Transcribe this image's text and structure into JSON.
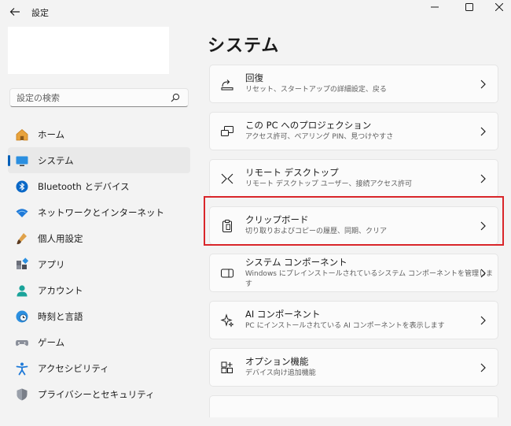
{
  "window": {
    "title": "設定"
  },
  "search": {
    "placeholder": "設定の検索"
  },
  "sidebar": {
    "items": [
      {
        "label": "ホーム",
        "icon": "home-icon",
        "selected": false
      },
      {
        "label": "システム",
        "icon": "system-display-icon",
        "selected": true
      },
      {
        "label": "Bluetooth とデバイス",
        "icon": "bluetooth-icon",
        "selected": false
      },
      {
        "label": "ネットワークとインターネット",
        "icon": "wifi-icon",
        "selected": false
      },
      {
        "label": "個人用設定",
        "icon": "paint-brush-icon",
        "selected": false
      },
      {
        "label": "アプリ",
        "icon": "apps-icon",
        "selected": false
      },
      {
        "label": "アカウント",
        "icon": "account-icon",
        "selected": false
      },
      {
        "label": "時刻と言語",
        "icon": "globe-clock-icon",
        "selected": false
      },
      {
        "label": "ゲーム",
        "icon": "gamepad-icon",
        "selected": false
      },
      {
        "label": "アクセシビリティ",
        "icon": "accessibility-icon",
        "selected": false
      },
      {
        "label": "プライバシーとセキュリティ",
        "icon": "shield-icon",
        "selected": false
      }
    ]
  },
  "main": {
    "title": "システム",
    "cards": [
      {
        "title": "回復",
        "description": "リセット、スタートアップの詳細設定、戻る",
        "icon": "recovery-icon"
      },
      {
        "title": "この PC へのプロジェクション",
        "description": "アクセス許可、ペアリング PIN、見つけやすさ",
        "icon": "projection-icon"
      },
      {
        "title": "リモート デスクトップ",
        "description": "リモート デスクトップ ユーザー、接続アクセス許可",
        "icon": "remote-desktop-icon"
      },
      {
        "title": "クリップボード",
        "description": "切り取りおよびコピーの履歴、同期、クリア",
        "icon": "clipboard-icon",
        "highlighted": true
      },
      {
        "title": "システム コンポーネント",
        "description": "Windows にプレインストールされているシステム コンポーネントを管理します",
        "icon": "system-components-icon"
      },
      {
        "title": "AI コンポーネント",
        "description": "PC にインストールされている AI コンポーネントを表示します",
        "icon": "ai-sparkle-icon"
      },
      {
        "title": "オプション機能",
        "description": "デバイス向け追加機能",
        "icon": "optional-features-icon"
      }
    ]
  },
  "colors": {
    "accent": "#005fb8",
    "highlight_box": "#d9262a",
    "background": "#f3f3f3",
    "card": "#fbfbfb"
  }
}
